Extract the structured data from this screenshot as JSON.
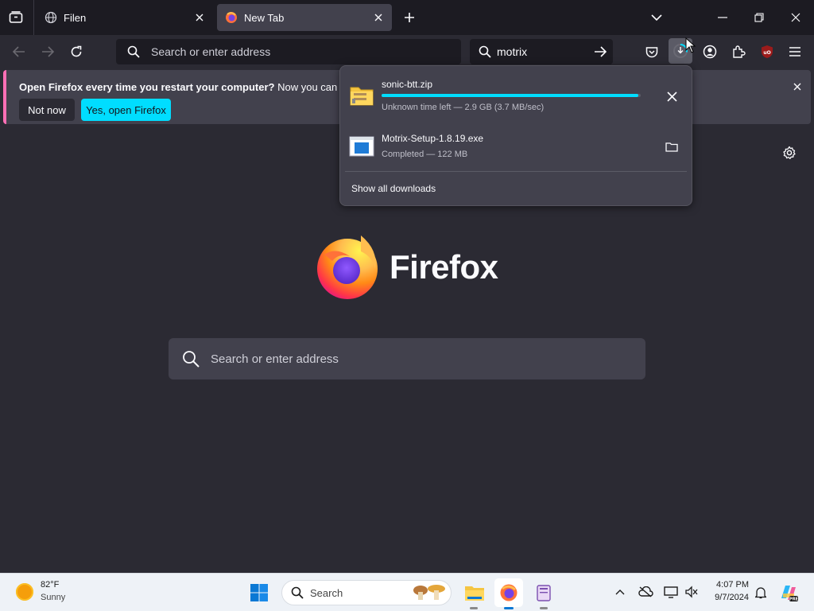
{
  "tabs": [
    {
      "title": "Filen"
    },
    {
      "title": "New Tab"
    }
  ],
  "toolbar": {
    "url_placeholder": "Search or enter address",
    "search_query": "motrix"
  },
  "notification": {
    "bold_text": "Open Firefox every time you restart your computer?",
    "body_text": "Now you can set Fire",
    "not_now_label": "Not now",
    "open_label": "Yes, open Firefox"
  },
  "downloads": {
    "items": [
      {
        "filename": "sonic-btt.zip",
        "status": "Unknown time left — 2.9 GB (3.7 MB/sec)",
        "progress": 0.99
      },
      {
        "filename": "Motrix-Setup-1.8.19.exe",
        "status": "Completed — 122 MB"
      }
    ],
    "show_all_label": "Show all downloads"
  },
  "newtab": {
    "brand": "Firefox",
    "search_placeholder": "Search or enter address"
  },
  "taskbar": {
    "weather_temp": "82°F",
    "weather_desc": "Sunny",
    "search_label": "Search",
    "time": "4:07 PM",
    "date": "9/7/2024"
  },
  "colors": {
    "accent": "#00ddff",
    "notification_stripe": "#ff6fb5"
  }
}
